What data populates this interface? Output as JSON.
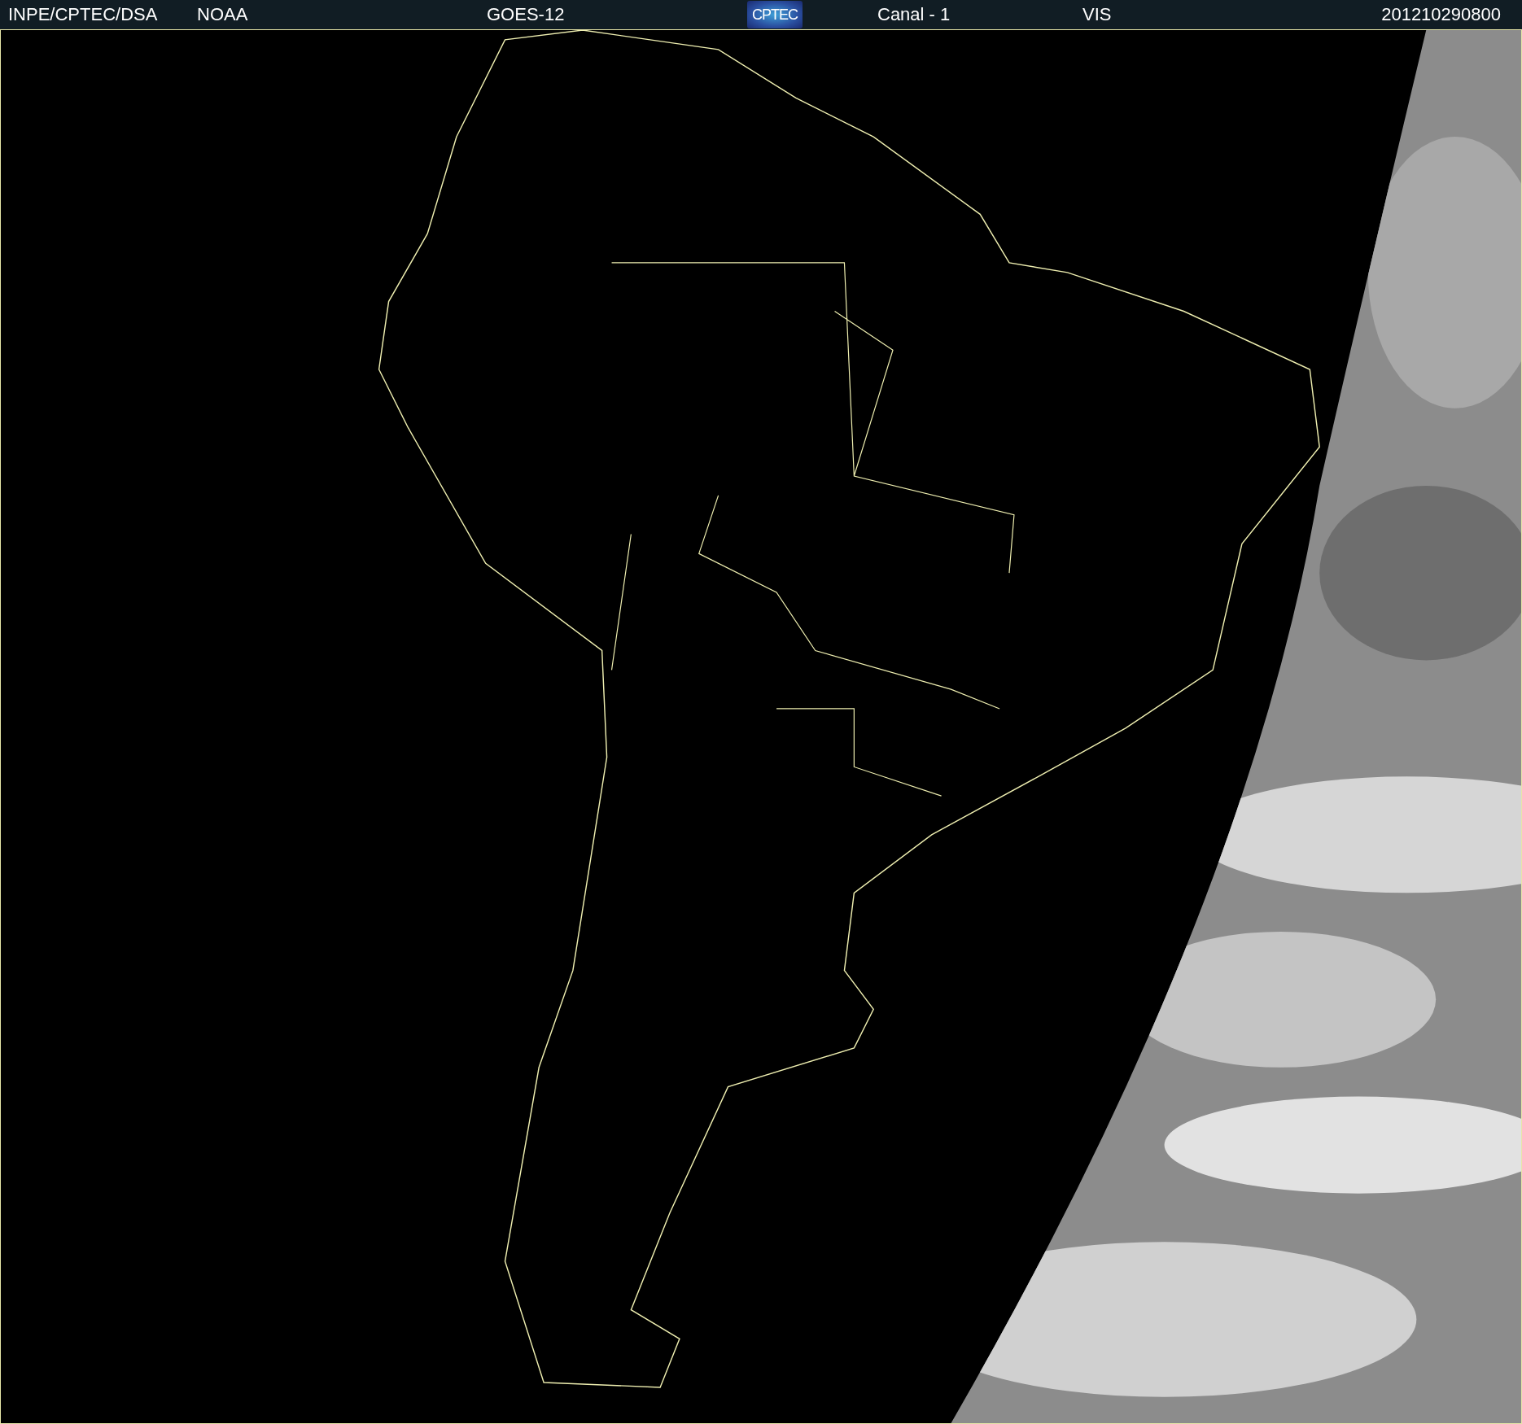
{
  "header": {
    "items": [
      {
        "kind": "text",
        "text": "INPE/CPTEC/DSA"
      },
      {
        "kind": "text",
        "text": "NOAA"
      },
      {
        "kind": "text",
        "text": "GOES-12"
      },
      {
        "kind": "logo",
        "text": "CPTEC"
      },
      {
        "kind": "text",
        "text": "Canal - 1"
      },
      {
        "kind": "text",
        "text": "VIS"
      },
      {
        "kind": "text",
        "text": "201210290800"
      }
    ]
  }
}
